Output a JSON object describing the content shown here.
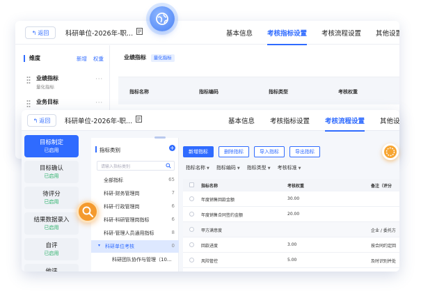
{
  "back_window": {
    "back_label": "返回",
    "title": "科研单位-2026年-职...",
    "tabs": [
      "基本信息",
      "考核指标设置",
      "考核流程设置",
      "其他设置"
    ],
    "active_tab": 1,
    "sidebar": {
      "header": "维度",
      "add_label": "新增",
      "weight_label": "权重",
      "items": [
        {
          "title": "业绩指标",
          "sub": "量化指标"
        },
        {
          "title": "业务目标",
          "sub": ""
        }
      ]
    },
    "main": {
      "section_title": "业绩指标",
      "section_tag": "量化指标",
      "columns": [
        "指标名称",
        "指标编码",
        "指标类型",
        "考核权重"
      ]
    }
  },
  "front_window": {
    "back_label": "返回",
    "title": "科研单位-2026年-职...",
    "tabs": [
      "基本信息",
      "考核指标设置",
      "考核流程设置",
      "其他设置"
    ],
    "active_tab": 2,
    "stages": [
      {
        "name": "目标制定",
        "status": "已启用",
        "active": true
      },
      {
        "name": "目标确认",
        "status": "已启用",
        "active": false
      },
      {
        "name": "待评分",
        "status": "已启用",
        "active": false
      },
      {
        "name": "结果数据录入",
        "status": "已启用",
        "active": false
      },
      {
        "name": "自评",
        "status": "已启用",
        "active": false
      },
      {
        "name": "他评",
        "status": "",
        "active": false
      }
    ],
    "categories": {
      "title": "指标类别",
      "search_placeholder": "请输入指标类别",
      "items": [
        {
          "label": "全部指标",
          "count": "65"
        },
        {
          "label": "科研-财务管理岗",
          "count": "7"
        },
        {
          "label": "科研-行政管理岗",
          "count": "6"
        },
        {
          "label": "科研-科研管理岗指标",
          "count": "6"
        },
        {
          "label": "科研-管理人员通用指标",
          "count": "8"
        },
        {
          "label": "科研单位考核",
          "count": "0",
          "active": true
        },
        {
          "label": "科研团队协作与管理（10...",
          "count": ""
        }
      ]
    },
    "toolbar": {
      "add": "新增指标",
      "delete": "删除指标",
      "import": "导入指标",
      "export": "导出指标"
    },
    "filters": [
      "指标名称",
      "指标编码",
      "指标类型",
      "考核标准"
    ],
    "table": {
      "columns": [
        "指标名称",
        "考核权重",
        "备注（评分"
      ],
      "rows": [
        {
          "name": "年度销售回款金额",
          "weight": "30.00",
          "note": ""
        },
        {
          "name": "年度销售合同签约金额",
          "weight": "20.00",
          "note": ""
        },
        {
          "name": "甲方满意度",
          "weight": "",
          "note": "企业 / 委托方"
        },
        {
          "name": "回款进度",
          "weight": "3.00",
          "note": "按合同约定回"
        },
        {
          "name": "风险管控",
          "weight": "5.00",
          "note": "及时识别并处"
        }
      ]
    }
  },
  "colors": {
    "accent": "#2f6bff",
    "enabled_green": "#27b066",
    "badge_orange": "#f7a531"
  }
}
